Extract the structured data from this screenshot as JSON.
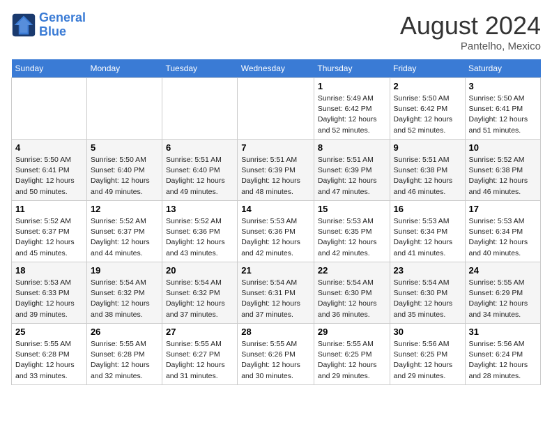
{
  "header": {
    "logo_line1": "General",
    "logo_line2": "Blue",
    "month_year": "August 2024",
    "location": "Pantelho, Mexico"
  },
  "days_of_week": [
    "Sunday",
    "Monday",
    "Tuesday",
    "Wednesday",
    "Thursday",
    "Friday",
    "Saturday"
  ],
  "weeks": [
    [
      {
        "day": "",
        "info": ""
      },
      {
        "day": "",
        "info": ""
      },
      {
        "day": "",
        "info": ""
      },
      {
        "day": "",
        "info": ""
      },
      {
        "day": "1",
        "info": "Sunrise: 5:49 AM\nSunset: 6:42 PM\nDaylight: 12 hours\nand 52 minutes."
      },
      {
        "day": "2",
        "info": "Sunrise: 5:50 AM\nSunset: 6:42 PM\nDaylight: 12 hours\nand 52 minutes."
      },
      {
        "day": "3",
        "info": "Sunrise: 5:50 AM\nSunset: 6:41 PM\nDaylight: 12 hours\nand 51 minutes."
      }
    ],
    [
      {
        "day": "4",
        "info": "Sunrise: 5:50 AM\nSunset: 6:41 PM\nDaylight: 12 hours\nand 50 minutes."
      },
      {
        "day": "5",
        "info": "Sunrise: 5:50 AM\nSunset: 6:40 PM\nDaylight: 12 hours\nand 49 minutes."
      },
      {
        "day": "6",
        "info": "Sunrise: 5:51 AM\nSunset: 6:40 PM\nDaylight: 12 hours\nand 49 minutes."
      },
      {
        "day": "7",
        "info": "Sunrise: 5:51 AM\nSunset: 6:39 PM\nDaylight: 12 hours\nand 48 minutes."
      },
      {
        "day": "8",
        "info": "Sunrise: 5:51 AM\nSunset: 6:39 PM\nDaylight: 12 hours\nand 47 minutes."
      },
      {
        "day": "9",
        "info": "Sunrise: 5:51 AM\nSunset: 6:38 PM\nDaylight: 12 hours\nand 46 minutes."
      },
      {
        "day": "10",
        "info": "Sunrise: 5:52 AM\nSunset: 6:38 PM\nDaylight: 12 hours\nand 46 minutes."
      }
    ],
    [
      {
        "day": "11",
        "info": "Sunrise: 5:52 AM\nSunset: 6:37 PM\nDaylight: 12 hours\nand 45 minutes."
      },
      {
        "day": "12",
        "info": "Sunrise: 5:52 AM\nSunset: 6:37 PM\nDaylight: 12 hours\nand 44 minutes."
      },
      {
        "day": "13",
        "info": "Sunrise: 5:52 AM\nSunset: 6:36 PM\nDaylight: 12 hours\nand 43 minutes."
      },
      {
        "day": "14",
        "info": "Sunrise: 5:53 AM\nSunset: 6:36 PM\nDaylight: 12 hours\nand 42 minutes."
      },
      {
        "day": "15",
        "info": "Sunrise: 5:53 AM\nSunset: 6:35 PM\nDaylight: 12 hours\nand 42 minutes."
      },
      {
        "day": "16",
        "info": "Sunrise: 5:53 AM\nSunset: 6:34 PM\nDaylight: 12 hours\nand 41 minutes."
      },
      {
        "day": "17",
        "info": "Sunrise: 5:53 AM\nSunset: 6:34 PM\nDaylight: 12 hours\nand 40 minutes."
      }
    ],
    [
      {
        "day": "18",
        "info": "Sunrise: 5:53 AM\nSunset: 6:33 PM\nDaylight: 12 hours\nand 39 minutes."
      },
      {
        "day": "19",
        "info": "Sunrise: 5:54 AM\nSunset: 6:32 PM\nDaylight: 12 hours\nand 38 minutes."
      },
      {
        "day": "20",
        "info": "Sunrise: 5:54 AM\nSunset: 6:32 PM\nDaylight: 12 hours\nand 37 minutes."
      },
      {
        "day": "21",
        "info": "Sunrise: 5:54 AM\nSunset: 6:31 PM\nDaylight: 12 hours\nand 37 minutes."
      },
      {
        "day": "22",
        "info": "Sunrise: 5:54 AM\nSunset: 6:30 PM\nDaylight: 12 hours\nand 36 minutes."
      },
      {
        "day": "23",
        "info": "Sunrise: 5:54 AM\nSunset: 6:30 PM\nDaylight: 12 hours\nand 35 minutes."
      },
      {
        "day": "24",
        "info": "Sunrise: 5:55 AM\nSunset: 6:29 PM\nDaylight: 12 hours\nand 34 minutes."
      }
    ],
    [
      {
        "day": "25",
        "info": "Sunrise: 5:55 AM\nSunset: 6:28 PM\nDaylight: 12 hours\nand 33 minutes."
      },
      {
        "day": "26",
        "info": "Sunrise: 5:55 AM\nSunset: 6:28 PM\nDaylight: 12 hours\nand 32 minutes."
      },
      {
        "day": "27",
        "info": "Sunrise: 5:55 AM\nSunset: 6:27 PM\nDaylight: 12 hours\nand 31 minutes."
      },
      {
        "day": "28",
        "info": "Sunrise: 5:55 AM\nSunset: 6:26 PM\nDaylight: 12 hours\nand 30 minutes."
      },
      {
        "day": "29",
        "info": "Sunrise: 5:55 AM\nSunset: 6:25 PM\nDaylight: 12 hours\nand 29 minutes."
      },
      {
        "day": "30",
        "info": "Sunrise: 5:56 AM\nSunset: 6:25 PM\nDaylight: 12 hours\nand 29 minutes."
      },
      {
        "day": "31",
        "info": "Sunrise: 5:56 AM\nSunset: 6:24 PM\nDaylight: 12 hours\nand 28 minutes."
      }
    ]
  ]
}
